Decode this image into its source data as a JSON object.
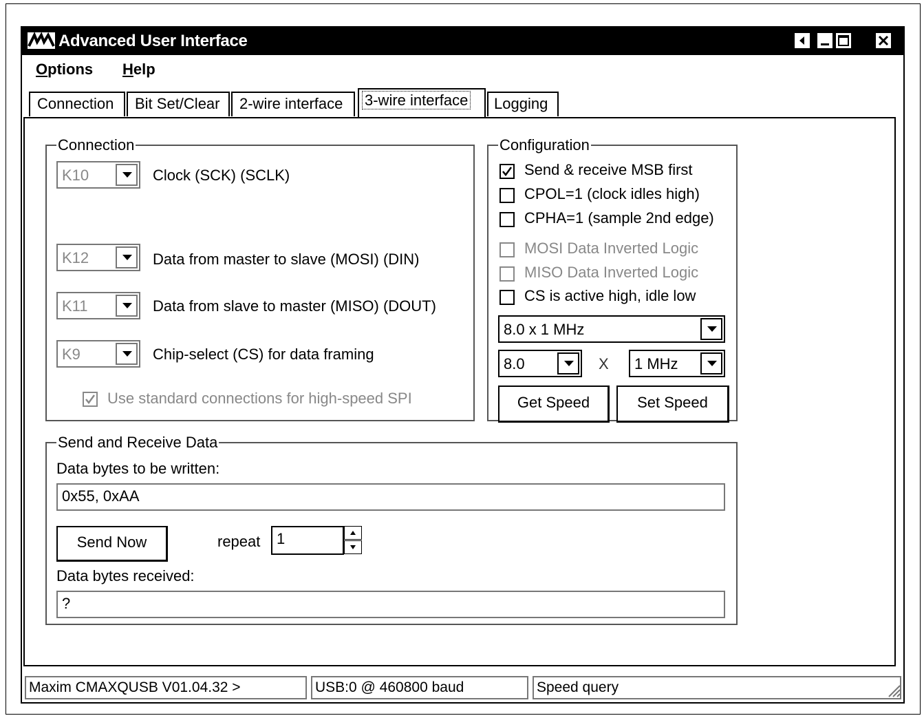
{
  "window": {
    "title": "Advanced User Interface"
  },
  "menu": {
    "options": "ptions",
    "options_accel": "O",
    "help": "elp",
    "help_accel": "H"
  },
  "tabs": [
    {
      "label": "Connection"
    },
    {
      "label": "Bit Set/Clear"
    },
    {
      "label": "2-wire interface"
    },
    {
      "label": "3-wire interface"
    },
    {
      "label": "Logging"
    }
  ],
  "connection": {
    "title": "Connection",
    "clock": {
      "value": "K10",
      "label": "Clock (SCK) (SCLK)"
    },
    "mosi": {
      "value": "K12",
      "label": "Data from master to slave (MOSI) (DIN)"
    },
    "miso": {
      "value": "K11",
      "label": "Data from slave to master (MISO) (DOUT)"
    },
    "cs": {
      "value": "K9",
      "label": "Chip-select (CS) for data framing"
    },
    "standard_label": "Use standard connections for high-speed SPI",
    "standard_checked": true
  },
  "configuration": {
    "title": "Configuration",
    "options": [
      {
        "label": "Send & receive MSB first",
        "checked": true,
        "enabled": true
      },
      {
        "label": "CPOL=1 (clock idles high)",
        "checked": false,
        "enabled": true
      },
      {
        "label": "CPHA=1 (sample 2nd edge)",
        "checked": false,
        "enabled": true
      },
      {
        "label": "MOSI Data Inverted Logic",
        "checked": false,
        "enabled": false
      },
      {
        "label": "MISO Data Inverted Logic",
        "checked": false,
        "enabled": false
      },
      {
        "label": "CS is active high, idle low",
        "checked": false,
        "enabled": true
      }
    ],
    "speed_select": "8.0 x 1 MHz",
    "multiplier": "8.0",
    "times": "X",
    "base": "1 MHz",
    "get_speed": "Get Speed",
    "set_speed": "Set Speed"
  },
  "send_receive": {
    "title": "Send and Receive Data",
    "write_label": "Data bytes to be written:",
    "write_value": "0x55, 0xAA",
    "send_now": "Send Now",
    "repeat_label": "repeat",
    "repeat_value": "1",
    "received_label": "Data bytes received:",
    "received_value": "?"
  },
  "status": {
    "device": "Maxim CMAXQUSB V01.04.32 >",
    "port": "USB:0 @ 460800 baud",
    "message": "Speed query"
  }
}
